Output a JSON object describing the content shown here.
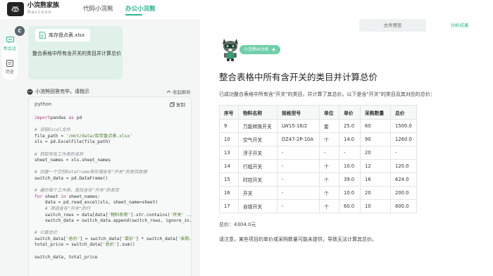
{
  "app": {
    "logo_glyph": "🦝",
    "name": "小浣熊家族",
    "name_en": "Raccoon"
  },
  "nav": {
    "tabs": [
      "代码小浣熊",
      "办公小浣熊"
    ],
    "active_index": 1
  },
  "rail": {
    "items": [
      {
        "label": "新会话",
        "icon": "new-chat-icon"
      },
      {
        "label": "历史",
        "icon": "history-icon"
      }
    ]
  },
  "chat": {
    "avatar_letter": "C",
    "file_name": "库存盘点表.xlsx",
    "user_message": "整合表格中所有含开关的类目并计算总价",
    "bot_status": "小浣熊回答完毕，请指示",
    "collapse_label": "收起解析",
    "code_language": "python",
    "copy_label": "复制",
    "code_lines": [
      [
        [
          "kw",
          "import"
        ],
        [
          "",
          "pandas "
        ],
        [
          "kw",
          "as"
        ],
        [
          "",
          " pd"
        ]
      ],
      [],
      [
        [
          "cm",
          "# 读取Excel文件"
        ]
      ],
      [
        [
          "",
          "file_path = "
        ],
        [
          "st",
          "'/mnt/data/库存盘点表.xlsx'"
        ]
      ],
      [
        [
          "",
          "xls = pd.ExcelFile(file_path)"
        ]
      ],
      [],
      [
        [
          "cm",
          "# 获取所有工作表的名称"
        ]
      ],
      [
        [
          "",
          "sheet_names = xls.sheet_names"
        ]
      ],
      [],
      [
        [
          "cm",
          "# 创建一个空的DataFrame来存储含有\"开关\"的类目数据"
        ]
      ],
      [
        [
          "",
          "switch_data = pd.DataFrame()"
        ]
      ],
      [],
      [
        [
          "cm",
          "# 遍历每个工作表，查找含有\"开关\"的类目"
        ]
      ],
      [
        [
          "kw",
          "for"
        ],
        [
          "",
          " sheet "
        ],
        [
          "kw",
          "in"
        ],
        [
          "",
          " sheet_names:"
        ]
      ],
      [
        [
          "",
          "    data = pd.read_excel(xls, sheet_name=sheet)"
        ]
      ],
      [
        [
          "cm",
          "    # 筛选含有\"开关\"的行"
        ]
      ],
      [
        [
          "",
          "    switch_rows = data[data["
        ],
        [
          "st",
          "'物料名称'"
        ],
        [
          "",
          "].str.contains("
        ],
        [
          "st",
          "'开关'"
        ],
        [
          "",
          " ..."
        ]
      ],
      [
        [
          "",
          "    switch_data = switch_data.append(switch_rows, ignore_in..."
        ]
      ],
      [],
      [
        [
          "cm",
          "# 计算总价"
        ]
      ],
      [
        [
          "",
          "switch_data["
        ],
        [
          "st",
          "'总价'"
        ],
        [
          "",
          "] = switch_data["
        ],
        [
          "st",
          "'单价'"
        ],
        [
          "",
          "] * switch_data["
        ],
        [
          "st",
          "'采购..."
        ]
      ],
      [
        [
          "",
          "total_price = switch_data["
        ],
        [
          "st",
          "'总价'"
        ],
        [
          "",
          "].sum()"
        ]
      ],
      [],
      [
        [
          "",
          "switch_data, total_price"
        ]
      ]
    ]
  },
  "panel": {
    "tabs": [
      "文件预览",
      "分析结果"
    ],
    "active_index": 1,
    "ai_badge": "小浣熊AI分析",
    "title": "整合表格中所有含开关的类目并计算总价",
    "description": "已成功整合表格中所有含\"开关\"的类目，并计算了其总价。以下是含\"开关\"的类目及其对应的总价：",
    "table": {
      "headers": [
        "序号",
        "物料名称",
        "规格型号",
        "单位",
        "单价",
        "采购数量",
        "总价"
      ],
      "rows": [
        [
          "9",
          "万能转换开关",
          "LW15-16/2",
          "套",
          "25.0",
          "60",
          "1500.0"
        ],
        [
          "10",
          "空气开关",
          "DZ47-2P-10A",
          "个",
          "14.0",
          "90",
          "1260.0"
        ],
        [
          "13",
          "浮子开关",
          "-",
          "-",
          "-",
          "20",
          "-"
        ],
        [
          "14",
          "行程开关",
          "-",
          "个",
          "10.0",
          "12",
          "120.0"
        ],
        [
          "15",
          "时控开关",
          "-",
          "个",
          "39.0",
          "16",
          "624.0"
        ],
        [
          "16",
          "开关",
          "-",
          "个",
          "10.0",
          "20",
          "200.0"
        ],
        [
          "17",
          "自锁开关",
          "-",
          "个",
          "60.0",
          "10",
          "600.0"
        ]
      ]
    },
    "total": "总价：4304.0元",
    "note": "请注意，某些项目的单价或采购数量可能未提供，导致无法计算其总价。"
  },
  "colors": {
    "accent": "#2db38f",
    "bubble": "#dff1e8",
    "badge": "#6fcfa8"
  }
}
